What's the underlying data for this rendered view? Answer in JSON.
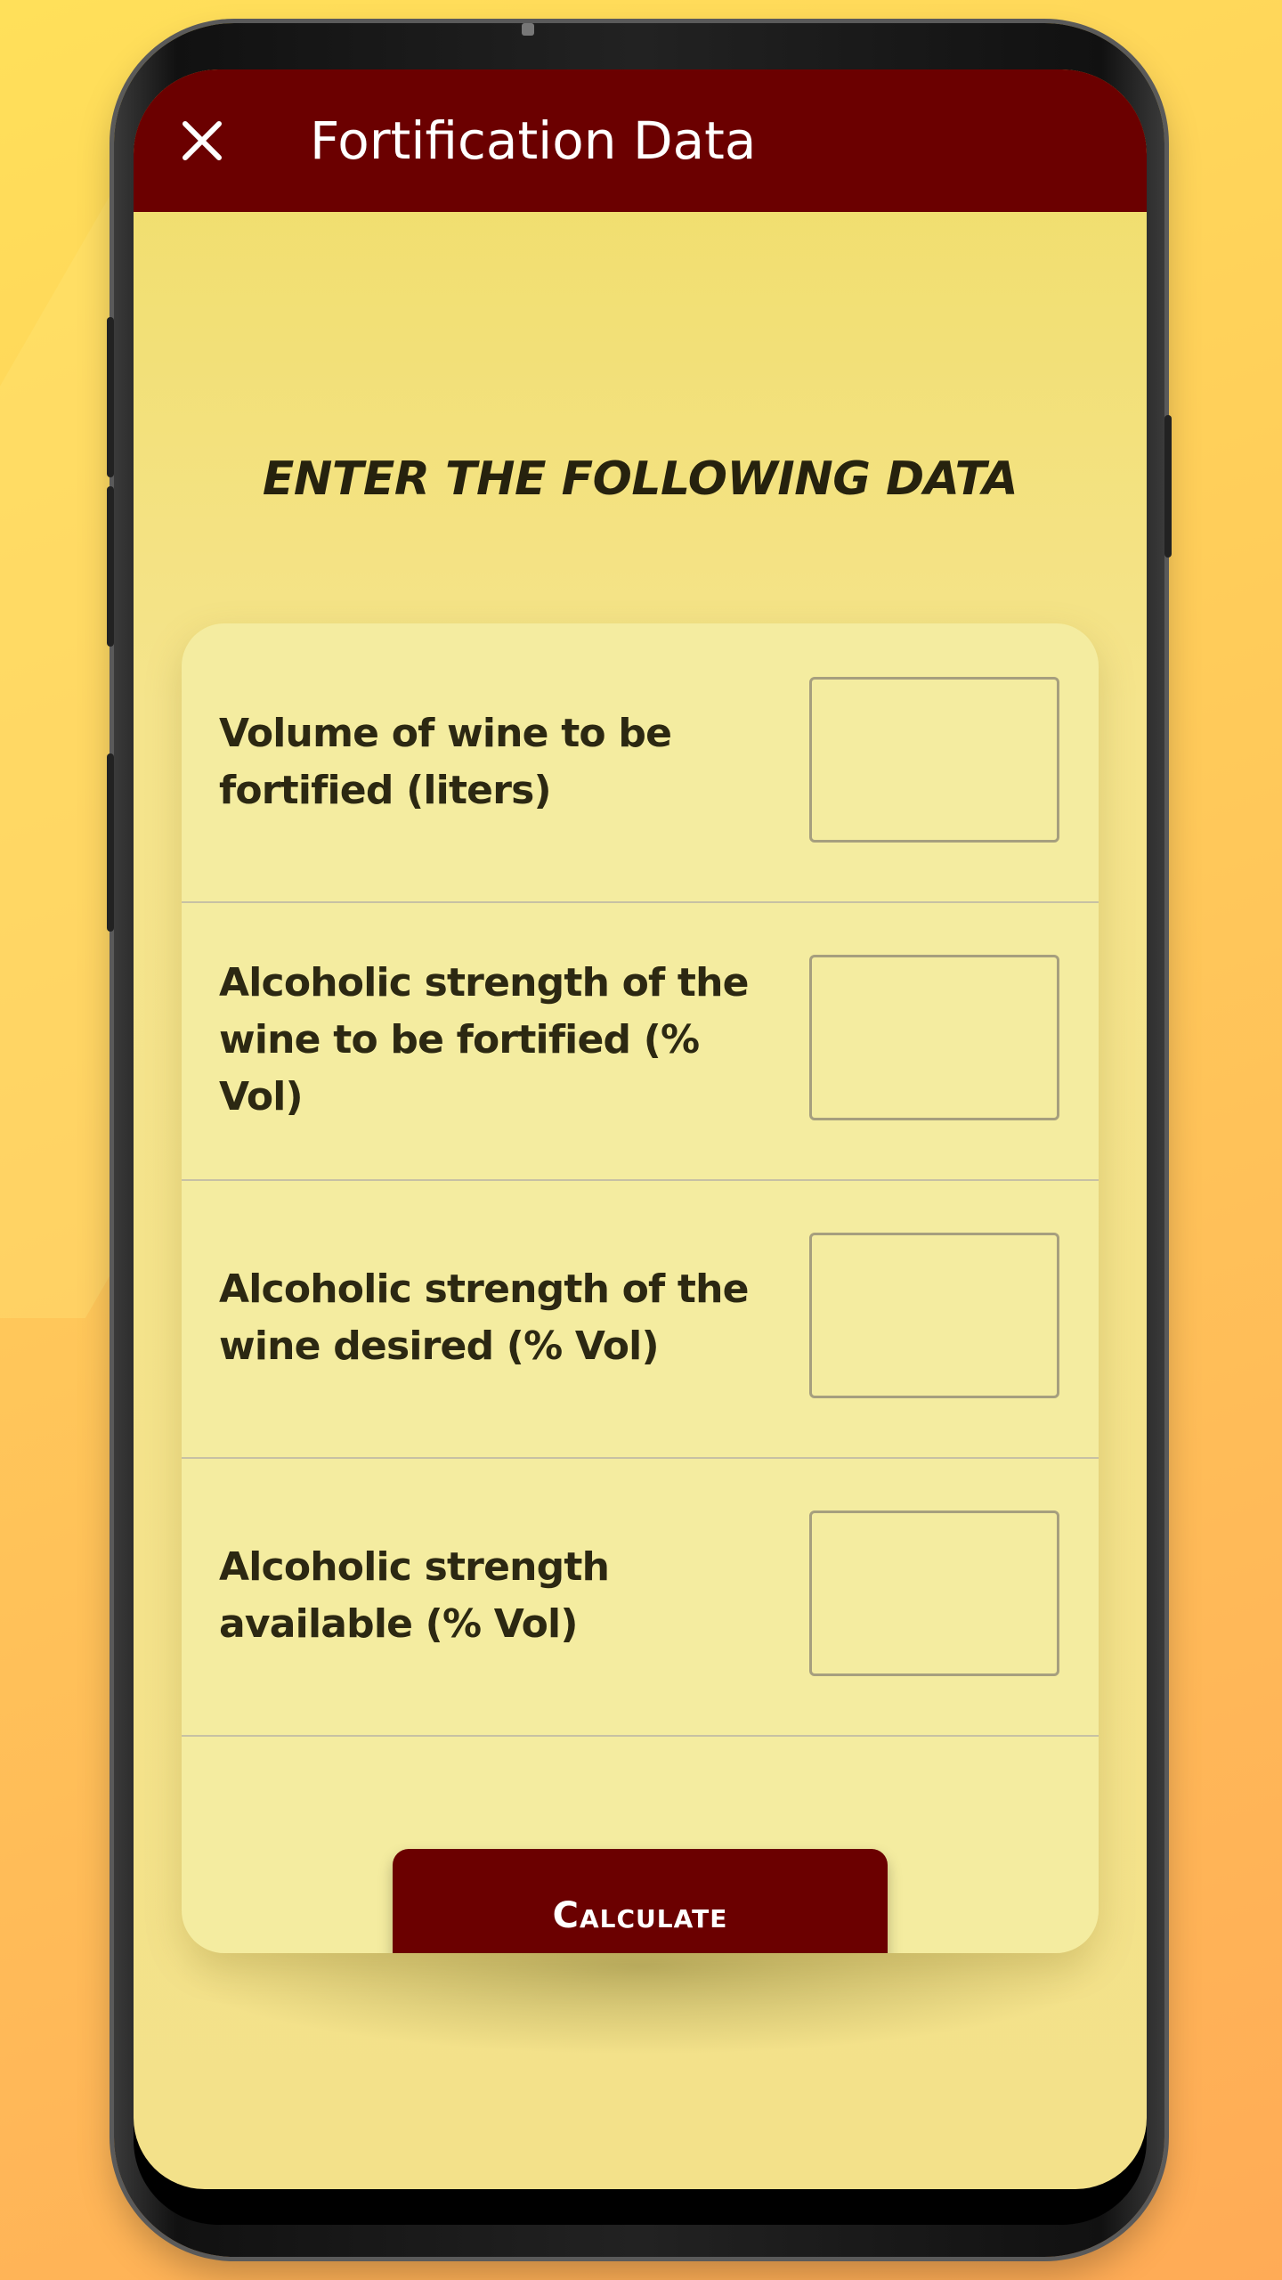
{
  "app": {
    "title": "Fortification Data",
    "close_icon": "close-icon"
  },
  "colors": {
    "appbar": "#6b0000",
    "screen_background": "#f0dd68",
    "card_background": "#f4eca0",
    "button": "#6b0000"
  },
  "form": {
    "heading": "ENTER THE FOLLOWING DATA",
    "fields": [
      {
        "label": "Volume of wine to be fortified (liters)",
        "value": "",
        "placeholder": ""
      },
      {
        "label": "Alcoholic strength of the wine to be fortified (% Vol)",
        "value": "",
        "placeholder": ""
      },
      {
        "label": "Alcoholic strength of the wine desired (% Vol)",
        "value": "",
        "placeholder": ""
      },
      {
        "label": "Alcoholic strength available (% Vol)",
        "value": "",
        "placeholder": ""
      }
    ],
    "calculate_label": "Calculate"
  }
}
